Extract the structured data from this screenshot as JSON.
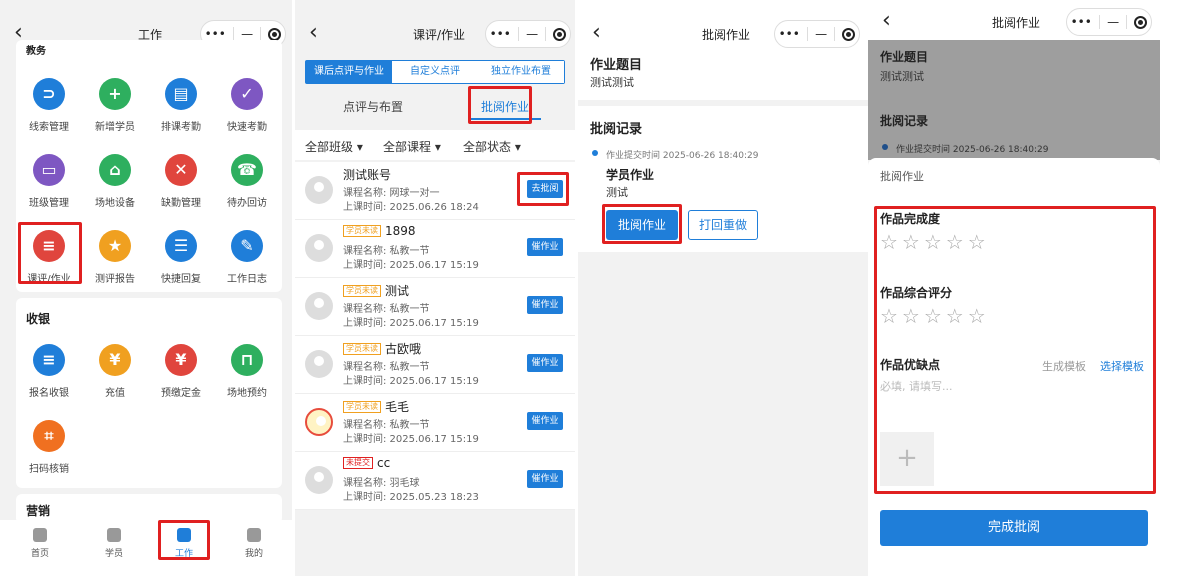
{
  "panel1": {
    "nav_title": "工作",
    "section_cut": "教务",
    "grid1": [
      {
        "label": "线索管理",
        "icon": "link-icon",
        "color": "#1f7ed9",
        "glyph": "⊃"
      },
      {
        "label": "新增学员",
        "icon": "add-user-icon",
        "color": "#2eaf5f",
        "glyph": "+"
      },
      {
        "label": "排课考勤",
        "icon": "schedule-icon",
        "color": "#1f7ed9",
        "glyph": "▤"
      },
      {
        "label": "快速考勤",
        "icon": "check-icon",
        "color": "#7e57c2",
        "glyph": "✓"
      },
      {
        "label": "班级管理",
        "icon": "class-icon",
        "color": "#7e57c2",
        "glyph": "▭"
      },
      {
        "label": "场地设备",
        "icon": "venue-icon",
        "color": "#2eaf5f",
        "glyph": "⌂"
      },
      {
        "label": "缺勤管理",
        "icon": "absence-icon",
        "color": "#e0453d",
        "glyph": "✕"
      },
      {
        "label": "待办回访",
        "icon": "phone-icon",
        "color": "#2eaf5f",
        "glyph": "☎"
      },
      {
        "label": "课评/作业",
        "icon": "homework-icon",
        "color": "#e0453d",
        "glyph": "≡"
      },
      {
        "label": "测评报告",
        "icon": "report-icon",
        "color": "#f0a020",
        "glyph": "★"
      },
      {
        "label": "快捷回复",
        "icon": "reply-icon",
        "color": "#1f7ed9",
        "glyph": "☰"
      },
      {
        "label": "工作日志",
        "icon": "pen-icon",
        "color": "#1f7ed9",
        "glyph": "✎"
      }
    ],
    "section2": "收银",
    "grid2": [
      {
        "label": "报名收银",
        "icon": "cashier-icon",
        "color": "#1f7ed9",
        "glyph": "≡"
      },
      {
        "label": "充值",
        "icon": "recharge-icon",
        "color": "#f0a020",
        "glyph": "¥"
      },
      {
        "label": "预缴定金",
        "icon": "deposit-icon",
        "color": "#e0453d",
        "glyph": "¥"
      },
      {
        "label": "场地预约",
        "icon": "booking-icon",
        "color": "#2eaf5f",
        "glyph": "⊓"
      },
      {
        "label": "扫码核销",
        "icon": "scan-icon",
        "color": "#f07020",
        "glyph": "⌗"
      }
    ],
    "section3": "营销",
    "tabs": [
      {
        "label": "首页",
        "icon": "home-icon"
      },
      {
        "label": "学员",
        "icon": "student-icon"
      },
      {
        "label": "工作",
        "icon": "work-icon"
      },
      {
        "label": "我的",
        "icon": "profile-icon"
      }
    ]
  },
  "panel2": {
    "nav_title": "课评/作业",
    "segments": [
      "课后点评与作业",
      "自定义点评",
      "独立作业布置"
    ],
    "subtabs": [
      "点评与布置",
      "批阅作业"
    ],
    "filters": [
      "全部班级 ▾",
      "全部课程 ▾",
      "全部状态 ▾"
    ],
    "rows": [
      {
        "name": "测试账号",
        "tag": "",
        "course": "课程名称: 网球一对一",
        "time": "上课时间: 2025.06.26 18:24",
        "btn": "去批阅"
      },
      {
        "name": "1898",
        "tag": "学员未读",
        "course": "课程名称: 私教一节",
        "time": "上课时间: 2025.06.17 15:19",
        "btn": "催作业"
      },
      {
        "name": "测试",
        "tag": "学员未读",
        "course": "课程名称: 私教一节",
        "time": "上课时间: 2025.06.17 15:19",
        "btn": "催作业"
      },
      {
        "name": "古欧哦",
        "tag": "学员未读",
        "course": "课程名称: 私教一节",
        "time": "上课时间: 2025.06.17 15:19",
        "btn": "催作业"
      },
      {
        "name": "毛毛",
        "tag": "学员未读",
        "course": "课程名称: 私教一节",
        "time": "上课时间: 2025.06.17 15:19",
        "btn": "催作业"
      },
      {
        "name": "cc",
        "tag": "未提交",
        "course": "课程名称: 羽毛球",
        "time": "上课时间: 2025.05.23 18:23",
        "btn": "催作业"
      }
    ]
  },
  "panel3": {
    "nav_title": "批阅作业",
    "hw_title_label": "作业题目",
    "hw_title_value": "测试测试",
    "record_label": "批阅记录",
    "submit_time": "作业提交时间 2025-06-26 18:40:29",
    "student_hw_label": "学员作业",
    "student_hw_value": "测试",
    "btn_review": "批阅作业",
    "btn_redo": "打回重做"
  },
  "panel4": {
    "nav_title": "批阅作业",
    "hw_title_label": "作业题目",
    "hw_title_value": "测试测试",
    "record_label": "批阅记录",
    "submit_time": "作业提交时间 2025-06-26 18:40:29",
    "sheet_title": "批阅作业",
    "completion_label": "作品完成度",
    "overall_label": "作品综合评分",
    "pros_cons_label": "作品优缺点",
    "gen_template": "生成模板",
    "choose_template": "选择模板",
    "placeholder": "必填, 请填写...",
    "finish_btn": "完成批阅",
    "completion_stars": 0,
    "overall_stars": 0
  }
}
